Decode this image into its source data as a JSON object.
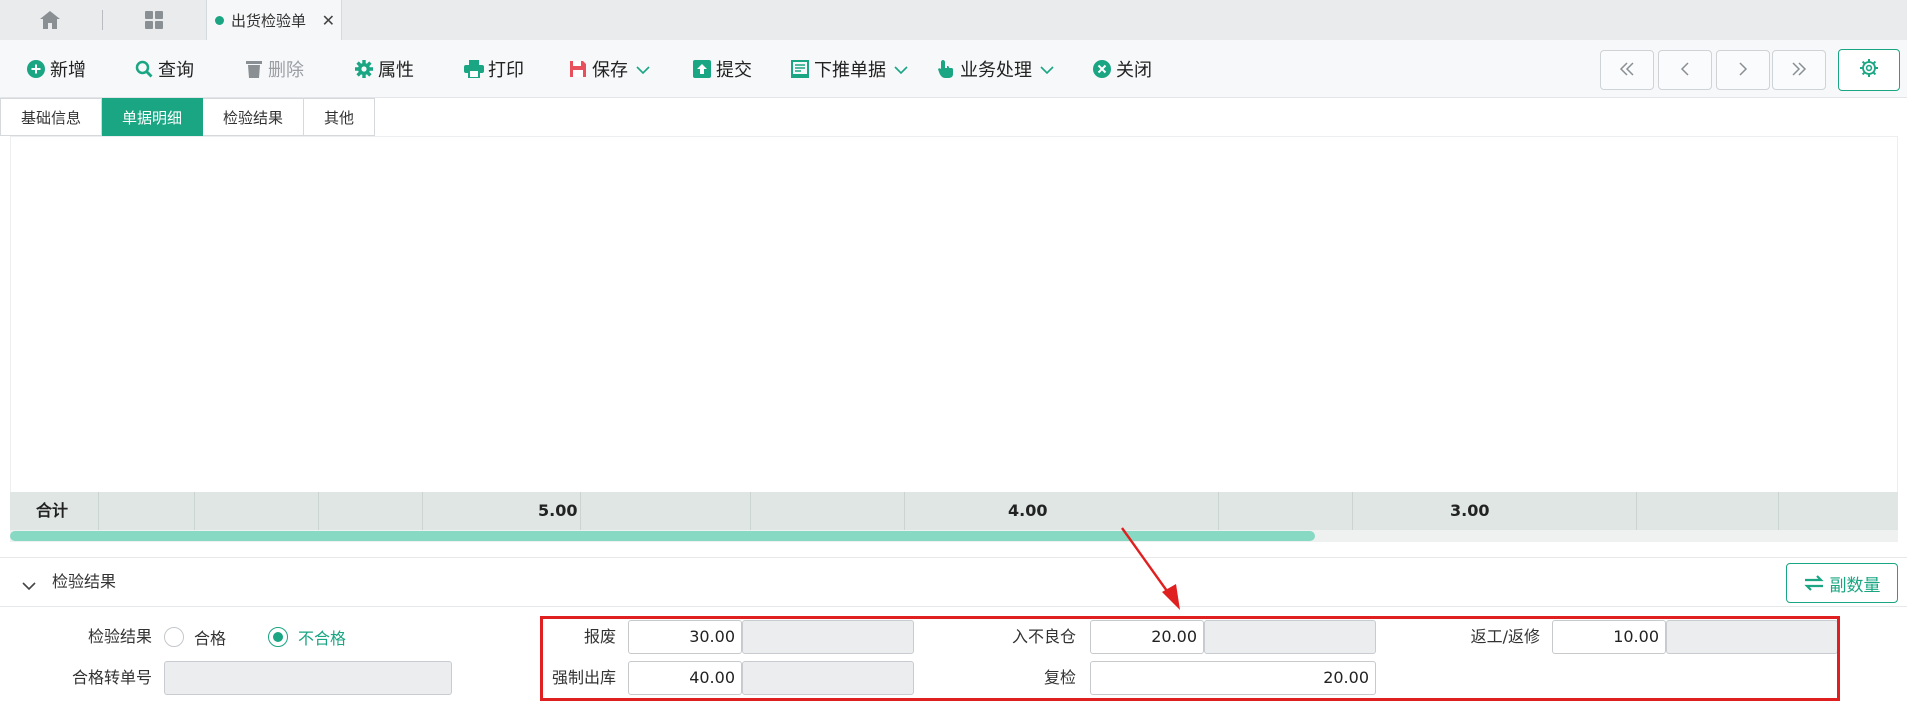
{
  "topbar": {
    "home_icon": "home-icon",
    "grid_icon": "apps-grid-icon",
    "doc_tab": {
      "label": "出货检验单",
      "close": "✕"
    }
  },
  "toolbar": {
    "items": [
      {
        "label": "新增",
        "icon": "plus-circle-icon",
        "disabled": false
      },
      {
        "label": "查询",
        "icon": "search-icon",
        "disabled": false
      },
      {
        "label": "删除",
        "icon": "trash-icon",
        "disabled": true
      },
      {
        "label": "属性",
        "icon": "gear-icon",
        "disabled": false
      },
      {
        "label": "打印",
        "icon": "printer-icon",
        "disabled": false
      },
      {
        "label": "保存",
        "icon": "save-icon",
        "disabled": false,
        "dropdown": true
      },
      {
        "label": "提交",
        "icon": "upload-icon",
        "disabled": false
      },
      {
        "label": "下推单据",
        "icon": "document-push-icon",
        "disabled": false,
        "dropdown": true
      },
      {
        "label": "业务处理",
        "icon": "hand-pointer-icon",
        "disabled": false,
        "dropdown": true
      },
      {
        "label": "关闭",
        "icon": "close-circle-icon",
        "disabled": false
      }
    ],
    "nav": [
      "first-page-icon",
      "prev-page-icon",
      "next-page-icon",
      "last-page-icon"
    ],
    "settings_icon": "settings-icon"
  },
  "subtabs": [
    "基础信息",
    "单据明细",
    "检验结果",
    "其他"
  ],
  "active_subtab": "单据明细",
  "grid": {
    "total_label": "合计",
    "totals": [
      "5.00",
      "4.00",
      "3.00"
    ]
  },
  "section": {
    "title": "检验结果",
    "sub_qty_button": "副数量"
  },
  "form": {
    "result_label": "检验结果",
    "result_options": [
      "合格",
      "不合格"
    ],
    "result_selected": "不合格",
    "pass_transfer_label": "合格转单号",
    "pass_transfer_value": "",
    "scrap_label": "报废",
    "scrap_value": "30.00",
    "forced_out_label": "强制出库",
    "forced_out_value": "40.00",
    "defective_wh_label": "入不良仓",
    "defective_wh_value": "20.00",
    "recheck_label": "复检",
    "recheck_value": "20.00",
    "rework_label": "返工/返修",
    "rework_value": "10.00"
  },
  "colors": {
    "accent": "#1aa583",
    "highlight_box": "#e02020"
  }
}
